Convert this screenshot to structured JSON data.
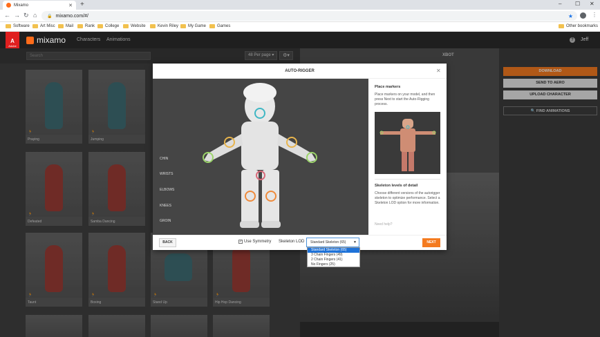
{
  "browser": {
    "tab_title": "Mixamo",
    "url": "mixamo.com/#/",
    "bookmarks": [
      "Software",
      "Art Misc",
      "Mail",
      "Rank",
      "College",
      "Website",
      "Kevin Riley",
      "My Game",
      "Games"
    ],
    "other_bookmarks": "Other bookmarks"
  },
  "header": {
    "adobe": "A",
    "adobe_sub": "Adobe",
    "logo": "mixamo",
    "nav": [
      "Characters",
      "Animations"
    ],
    "user": "Jeff"
  },
  "toolbar": {
    "search_placeholder": "Search",
    "per_page": "48 Per page"
  },
  "viewport": {
    "character_name": "XBOT"
  },
  "sidebar": {
    "download": "DOWNLOAD",
    "send_to_aero": "SEND TO AERO",
    "upload": "UPLOAD CHARACTER",
    "find": "FIND ANIMATIONS"
  },
  "cards": [
    {
      "label": "Praying",
      "color": "#3f6d74"
    },
    {
      "label": "Jumping",
      "color": "#3f6d74"
    },
    {
      "label": "Defeated",
      "color": "#9a3c35"
    },
    {
      "label": "Samba Dancing",
      "color": "#9a3c35"
    },
    {
      "label": "Taunt",
      "color": "#9a3c35"
    },
    {
      "label": "Boxing",
      "color": "#9a3c35"
    },
    {
      "label": "Stand Up",
      "color": "#3f6d74"
    },
    {
      "label": "Hip Hop Dancing",
      "color": "#9a3c35"
    }
  ],
  "modal": {
    "title": "AUTO-RIGGER",
    "markers": [
      "CHIN",
      "WRISTS",
      "ELBOWS",
      "KNEES",
      "GROIN"
    ],
    "place_heading": "Place markers",
    "place_text": "Place markers on your model, and then press Next to start the Auto-Rigging process.",
    "lod_heading": "Skeleton levels of detail",
    "lod_text": "Choose different versions of the autorigger skeleton to optimize performance. Select a Skeleton LOD option for more information.",
    "help": "Need help?",
    "back": "BACK",
    "symmetry": "Use Symmetry",
    "lod_label": "Skeleton LOD",
    "lod_value": "Standard Skeleton (65)",
    "next": "NEXT",
    "lod_options": [
      "Standard Skeleton (65)",
      "3 Chain Fingers (49)",
      "2 Chain Fingers (41)",
      "No Fingers (25)"
    ]
  }
}
